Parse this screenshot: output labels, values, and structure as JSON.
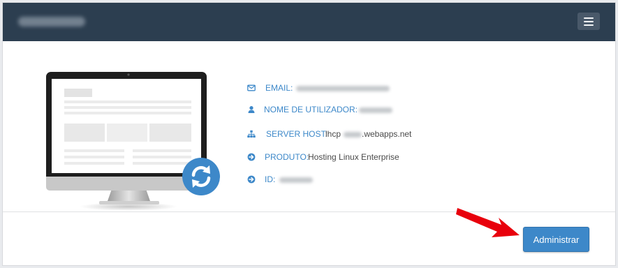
{
  "header": {
    "menu_icon": "hamburger-menu-icon",
    "background_color": "#2c3e50"
  },
  "details": [
    {
      "icon": "envelope-icon",
      "label": "EMAIL:",
      "value": ""
    },
    {
      "icon": "user-icon",
      "label": "NOME DE UTILIZADOR:",
      "value": ""
    },
    {
      "icon": "sitemap-icon",
      "label": "SERVER HOST:",
      "value_prefix": "lhcp",
      "value_suffix": ".webapps.net"
    },
    {
      "icon": "arrow-circle-right-icon",
      "label": "PRODUTO:",
      "value": "Hosting Linux Enterprise"
    },
    {
      "icon": "arrow-circle-right-icon",
      "label": "ID:",
      "value": ""
    }
  ],
  "actions": {
    "manage_label": "Administrar"
  },
  "colors": {
    "accent": "#3d88c9",
    "arrow": "#e8000c",
    "text": "#4a4a4a"
  }
}
